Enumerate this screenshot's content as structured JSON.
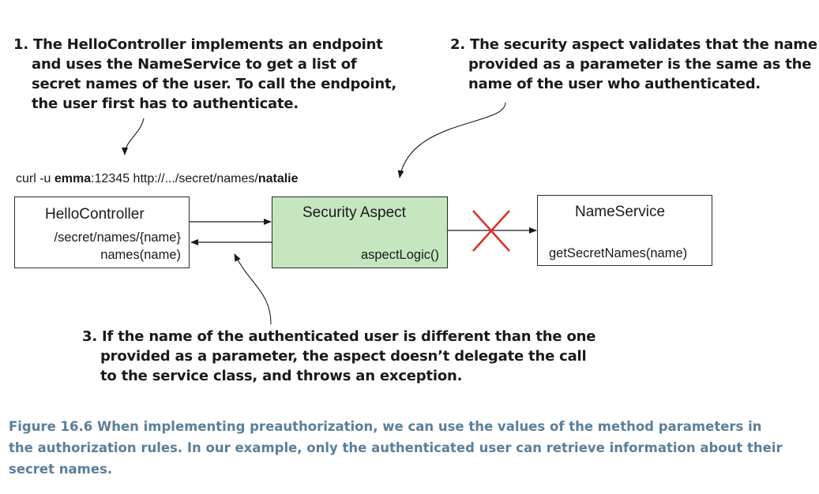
{
  "notes": {
    "note1": {
      "lines": [
        "1. The HelloController implements an endpoint",
        "and uses the NameService to get a list of",
        "secret names of the user. To call the endpoint,",
        "the user first has to authenticate."
      ]
    },
    "note2": {
      "lines": [
        "2. The security aspect validates that the name",
        "provided as a parameter is the same as the",
        "name of the user who authenticated."
      ]
    },
    "note3": {
      "lines": [
        "3. If the name of the authenticated user is different than the one",
        "provided as a parameter, the aspect doesn’t delegate the call",
        "to the service class, and throws an exception."
      ]
    }
  },
  "request": {
    "prefix": "curl -u ",
    "user": "emma",
    "middle": ":12345 http://.../secret/names/",
    "name": "natalie"
  },
  "boxes": {
    "hello_controller": {
      "title": "HelloController",
      "line1": "/secret/names/{name}",
      "line2": "names(name)"
    },
    "security_aspect": {
      "title": "Security Aspect",
      "method": "aspectLogic()",
      "fill": "#c6e6c0"
    },
    "name_service": {
      "title": "NameService",
      "method": "getSecretNames(name)"
    }
  },
  "colors": {
    "blocked_mark": "#e0302c",
    "caption": "#5b7f9a"
  },
  "caption": {
    "lines": [
      "Figure 16.6   When implementing preauthorization, we can use the values of the method parameters in",
      "the authorization rules. In our example, only the authenticated user can retrieve information about their",
      "secret names."
    ]
  }
}
